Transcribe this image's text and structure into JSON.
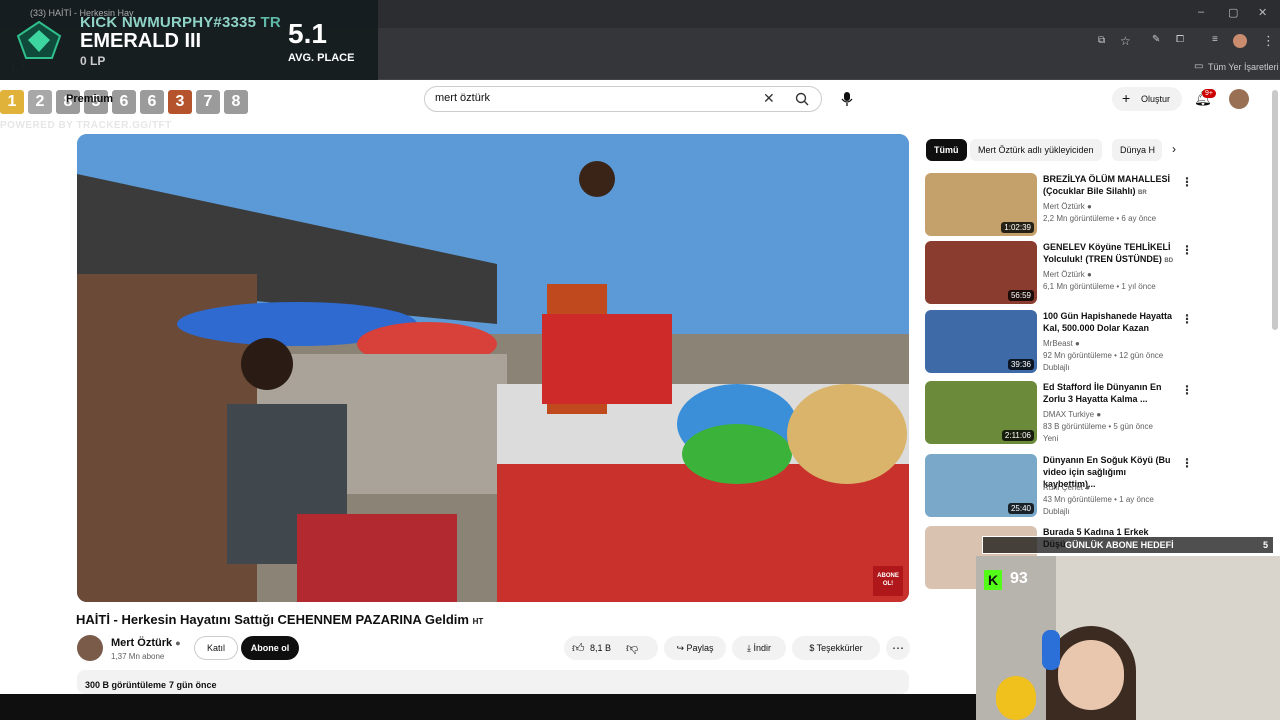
{
  "browser": {
    "tab_title": "(33) HAİTİ - Herkesin Hay",
    "bookmarks_label": "Tüm Yer İşaretleri"
  },
  "overlay": {
    "summoner": "KICK NWMURPHY#3335",
    "region": "TR",
    "rank": "EMERALD III",
    "lp": "0 LP",
    "avg_value": "5.1",
    "avg_label": "AVG. PLACE",
    "placements": [
      "1",
      "2",
      "8",
      "5",
      "6",
      "6",
      "3",
      "7",
      "8"
    ],
    "powered": "POWERED BY TRACKER.GG/TFT",
    "premium": "Premium"
  },
  "header": {
    "search_value": "mert öztürk",
    "create_label": "Oluştur",
    "notif_count": "9+"
  },
  "video": {
    "title": "HAİTİ - Herkesin Hayatını Sattığı CEHENNEM PAZARINA Geldim",
    "title_suffix": "HT",
    "channel": "Mert Öztürk",
    "subs": "1,37 Mn abone",
    "join_label": "Katıl",
    "subscribe_label": "Abone ol",
    "likes": "8,1 B",
    "share_label": "Paylaş",
    "download_label": "İndir",
    "thanks_label": "Teşekkürler",
    "views": "300 B görüntüleme",
    "age": "7 gün önce",
    "corner_badge": "ABONE OL!"
  },
  "chips": [
    "Tümü",
    "Mert Öztürk adlı yükleyiciden",
    "Dünya H"
  ],
  "recommendations": [
    {
      "title": "BREZİLYA ÖLÜM MAHALLESİ (Çocuklar Bile Silahlı)",
      "badge": "BR",
      "channel": "Mert Öztürk",
      "meta": "2,2 Mn görüntüleme • 6 ay önce",
      "duration": "1:02:39",
      "tag": ""
    },
    {
      "title": "GENELEV Köyüne TEHLİKELİ Yolculuk! (TREN ÜSTÜNDE)",
      "badge": "BD",
      "channel": "Mert Öztürk",
      "meta": "6,1 Mn görüntüleme • 1 yıl önce",
      "duration": "56:59",
      "tag": ""
    },
    {
      "title": "100 Gün Hapishanede Hayatta Kal, 500.000 Dolar Kazan",
      "badge": "",
      "channel": "MrBeast",
      "meta": "92 Mn görüntüleme • 12 gün önce",
      "duration": "39:36",
      "tag": "Dublajlı"
    },
    {
      "title": "Ed Stafford İle Dünyanın En Zorlu 3 Hayatta Kalma ...",
      "badge": "",
      "channel": "DMAX Turkiye",
      "meta": "83 B görüntüleme • 5 gün önce",
      "duration": "2:11:06",
      "tag": "Yeni"
    },
    {
      "title": "Dünyanın En Soğuk Köyü (Bu video için sağlığımı kaybettim)...",
      "badge": "",
      "channel": "Ruhi Çenet",
      "meta": "43 Mn görüntüleme • 1 ay önce",
      "duration": "25:40",
      "tag": "Dublajlı"
    },
    {
      "title": "Burada 5 Kadına 1 Erkek Düşü...",
      "badge": "",
      "channel": "",
      "meta": "",
      "duration": "",
      "tag": ""
    }
  ],
  "stream": {
    "goal_label": "GÜNLÜK ABONE HEDEFİ",
    "goal_value": "5",
    "kick_count": "93"
  },
  "colors": {
    "accent": "#ff0000",
    "overlay_bg": "#141c1e",
    "kick": "#53fc18"
  }
}
